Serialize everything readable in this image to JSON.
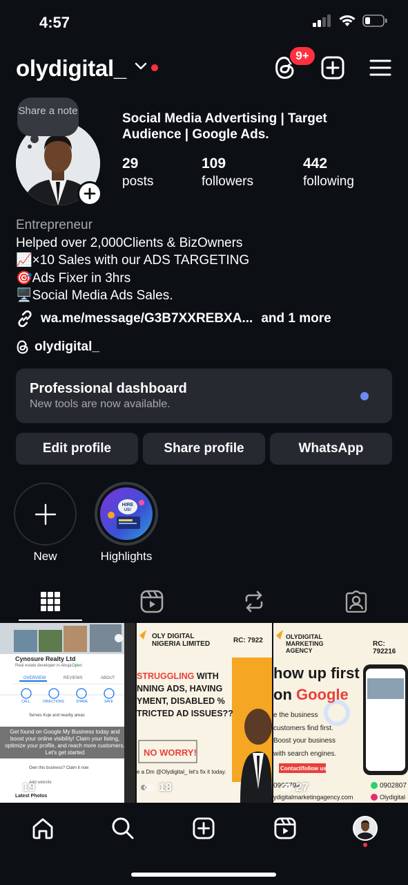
{
  "status_bar": {
    "time": "4:57"
  },
  "header": {
    "username": "olydigital_",
    "notification_count": "9+"
  },
  "profile": {
    "note_placeholder": "Share a note",
    "tagline": "Social Media Advertising | Target Audience | Google Ads.",
    "stats": [
      {
        "count": "29",
        "label": "posts"
      },
      {
        "count": "109",
        "label": "followers"
      },
      {
        "count": "442",
        "label": "following"
      }
    ],
    "bio": {
      "category": "Entrepreneur",
      "line1": "Helped over 2,000Clients & BizOwners",
      "line2": "📈×10 Sales with our ADS TARGETING",
      "line3": "🎯Ads Fixer in 3hrs",
      "line4": "🖥️Social Media Ads Sales."
    },
    "link": {
      "url": "wa.me/message/G3B7XXREBXA...",
      "more": "and 1 more"
    },
    "threads_handle": "olydigital_"
  },
  "pro_dashboard": {
    "title": "Professional dashboard",
    "subtitle": "New tools are now available."
  },
  "buttons": {
    "edit": "Edit profile",
    "share": "Share profile",
    "whatsapp": "WhatsApp"
  },
  "highlights": [
    {
      "label": "New"
    },
    {
      "label": "Highlights"
    }
  ],
  "posts": [
    {
      "views": "19",
      "business_name": "Cynosure Realty Ltd",
      "business_sub": "Real estate developer in Abuja",
      "open": "Open",
      "tabs": [
        "OVERVIEW",
        "REVIEWS",
        "ABOUT"
      ],
      "actions": [
        "CALL",
        "DIRECTIONS",
        "SHARE",
        "SAVE"
      ],
      "serves": "Serves Kuje and nearby areas",
      "caption": "Get found on Google My Business today and boost your online visibility! Claim your listing, optimize your profile, and reach more customers. Let's get started",
      "own": "Own this business? Claim it now",
      "add_website": "Add website",
      "latest": "Latest Photos"
    },
    {
      "views": "18",
      "brand": "OLY DIGITAL NIGERIA LIMITED",
      "rc": "RC: 7922",
      "headline_red": "STRUGGLING",
      "headline": [
        "WITH",
        "NNING ADS, HAVING",
        "YMENT, DISABLED %",
        "TRICTED AD ISSUES??"
      ],
      "cta": "NO WORRY!",
      "footer": "e a Dm @Olydigital_ let's fix it today."
    },
    {
      "views": "27",
      "brand": "OLYDIGITAL MARKETING AGENCY",
      "rc": "RC: 792216",
      "headline1": "how up first",
      "headline2_pre": "on ",
      "headline2": "Google",
      "lines": [
        "e the business",
        "customers find first.",
        "Boost your business",
        "with search engines."
      ],
      "contact": "Contact/follow us",
      "phone1": "0906794",
      "phone2": "0902807",
      "site": "ydigitalmarketingagency.com",
      "ig": "Olydigital"
    }
  ],
  "colors": {
    "background": "#0c1014",
    "card": "#262a30",
    "accent_red": "#ff3040",
    "dot_blue": "#6b8cf5"
  }
}
